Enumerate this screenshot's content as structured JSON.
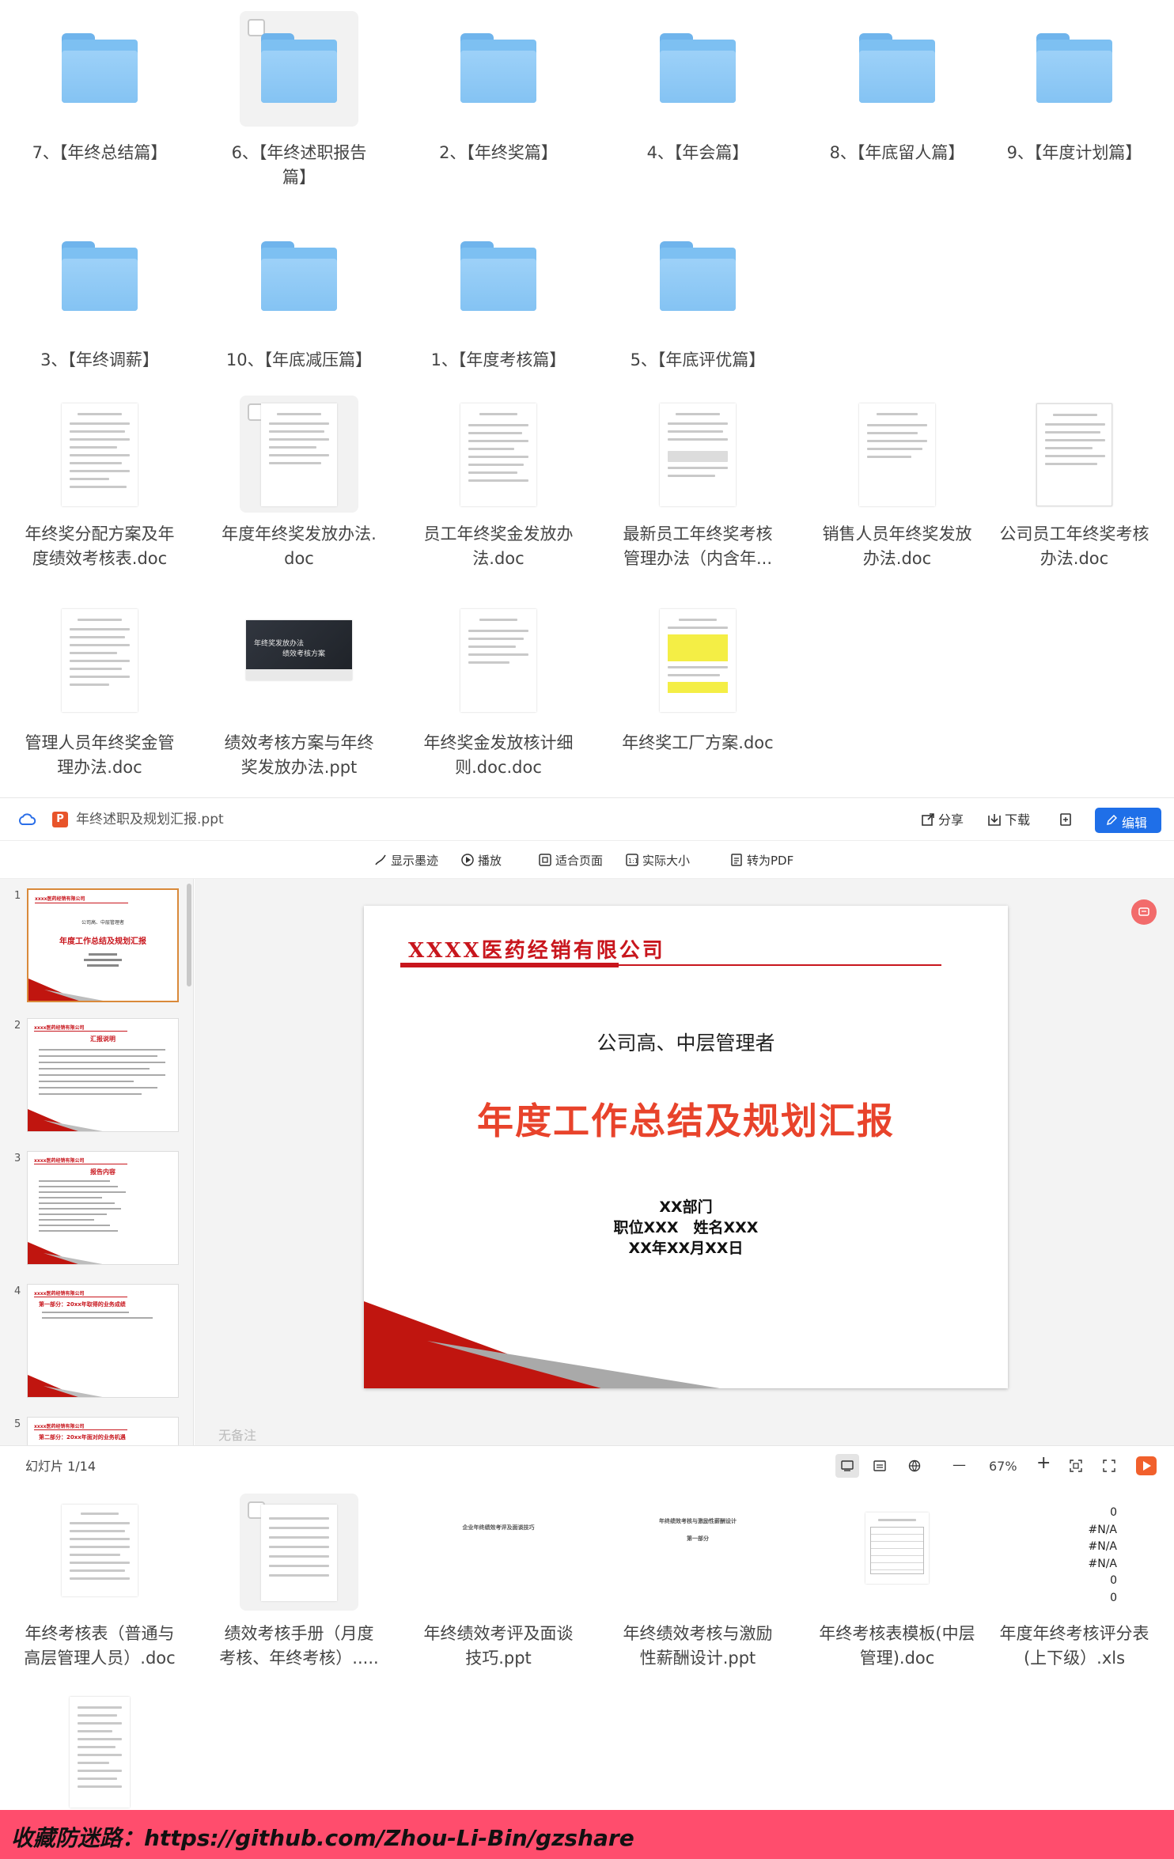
{
  "folders_row1": [
    {
      "label": "7、【年终总结篇】"
    },
    {
      "label": "6、【年终述职报告\n篇】",
      "selected": true
    },
    {
      "label": "2、【年终奖篇】"
    },
    {
      "label": "4、【年会篇】"
    },
    {
      "label": "8、【年底留人篇】"
    },
    {
      "label": "9、【年度计划篇】"
    }
  ],
  "folders_row2": [
    {
      "label": "3、【年终调薪】"
    },
    {
      "label": "10、【年底减压篇】"
    },
    {
      "label": "1、【年度考核篇】"
    },
    {
      "label": "5、【年底评优篇】"
    }
  ],
  "files_row1": [
    {
      "label": "年终奖分配方案及年\n度绩效考核表.doc"
    },
    {
      "label": "年度年终奖发放办法.\ndoc",
      "selected": true
    },
    {
      "label": "员工年终奖金发放办\n法.doc"
    },
    {
      "label": "最新员工年终奖考核\n管理办法（内含年..."
    },
    {
      "label": "销售人员年终奖发放\n办法.doc"
    },
    {
      "label": "公司员工年终奖考核\n办法.doc"
    }
  ],
  "files_row2": [
    {
      "label": "管理人员年终奖金管\n理办法.doc"
    },
    {
      "label": "绩效考核方案与年终\n奖发放办法.ppt",
      "ppt_line1": "年终奖发放办法",
      "ppt_line2": "绩效考核方案"
    },
    {
      "label": "年终奖金发放核计细\n则.doc.doc"
    },
    {
      "label": "年终奖工厂方案.doc"
    }
  ],
  "viewer": {
    "filename": "年终述职及规划汇报.ppt",
    "share": "分享",
    "download": "下载",
    "edit": "编辑",
    "toolbar": {
      "ink": "显示墨迹",
      "play": "播放",
      "fit": "适合页面",
      "actual": "实际大小",
      "pdf": "转为PDF"
    },
    "slide": {
      "company": "XXXX医药经销有限公司",
      "audience": "公司高、中层管理者",
      "title": "年度工作总结及规划汇报",
      "dept": "XX部门",
      "position": "职位XXX　姓名XXX",
      "date": "XX年XX月XX日"
    },
    "notes_placeholder": "无备注",
    "status": "幻灯片 1/14",
    "zoom": "67%",
    "zoom_minus": "—",
    "zoom_plus": "+",
    "thumbs": [
      {
        "num": "1",
        "title": "年度工作总结及规划汇报",
        "sub": "公司高、中层管理者"
      },
      {
        "num": "2",
        "title": "汇报说明"
      },
      {
        "num": "3",
        "title": "报告内容"
      },
      {
        "num": "4",
        "title": "第一部分：20xx年取得的业务成绩"
      },
      {
        "num": "5",
        "title": "第二部分：20xx年面对的业务机遇"
      }
    ],
    "thumb_company": "xxxx医药经销有限公司"
  },
  "files_row3": [
    {
      "label": "年终考核表（普通与\n高层管理人员）.doc"
    },
    {
      "label": "绩效考核手册（月度\n考核、年终考核）.....",
      "selected": true
    },
    {
      "label": "年终绩效考评及面谈\n技巧.ppt",
      "ppt_title": "企业年终绩效考评及面谈技巧"
    },
    {
      "label": "年终绩效考核与激励\n性薪酬设计.ppt",
      "ppt_title": "年终绩效考核与激励性薪酬设计",
      "ppt_sub": "第一部分"
    },
    {
      "label": "年终考核表模板(中层\n管理).doc"
    },
    {
      "label": "年度年终考核评分表\n(上下级）.xls",
      "xls_values": [
        "0",
        "#N/A",
        "#N/A",
        "#N/A",
        "0",
        "0"
      ]
    }
  ],
  "banner": "收藏防迷路：https://github.com/Zhou-Li-Bin/gzshare",
  "colors": {
    "accent": "#1f6fe8",
    "banner": "#ff4d6d",
    "slide_red": "#c8161d"
  }
}
